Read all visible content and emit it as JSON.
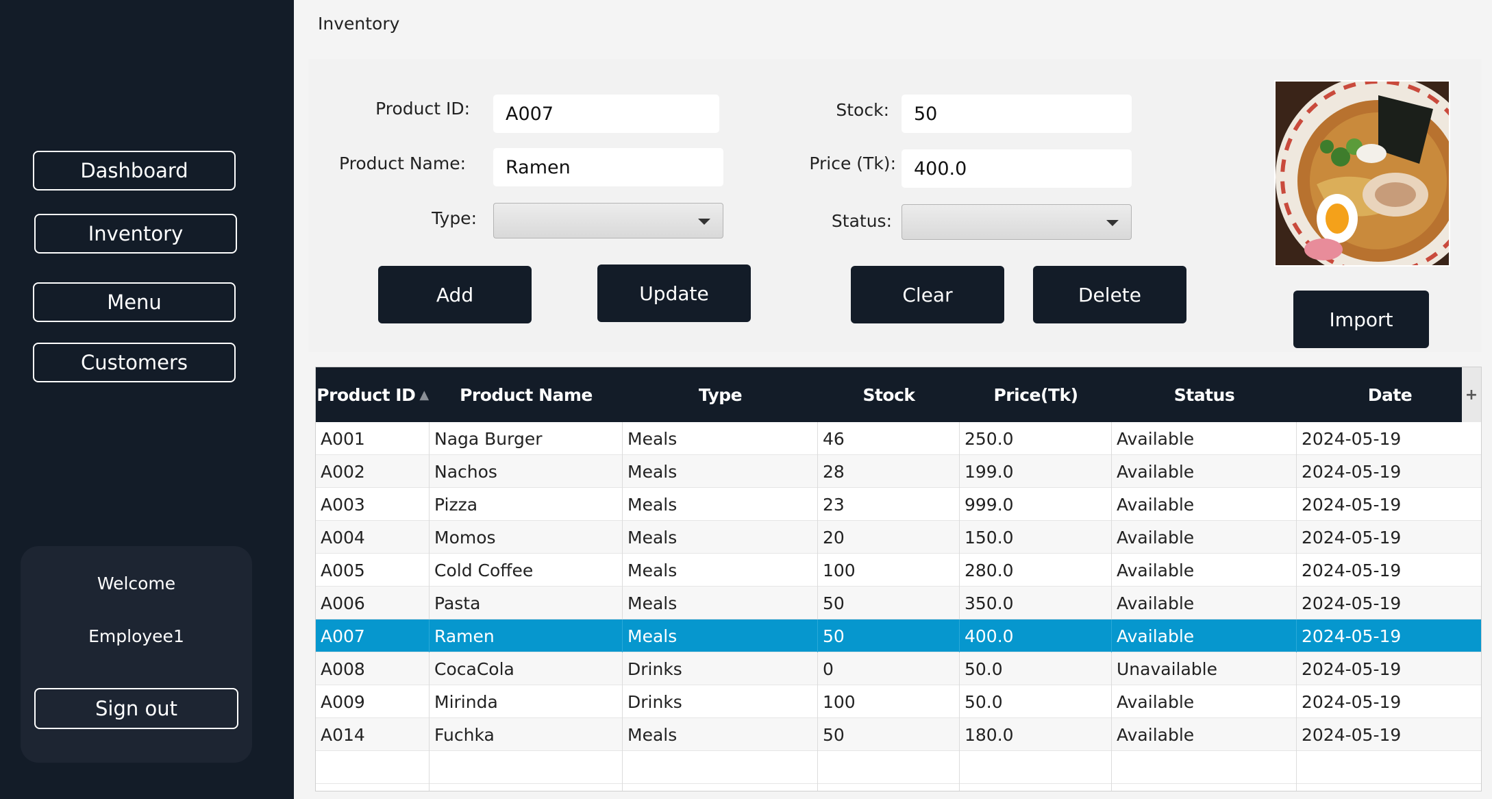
{
  "sidebar": {
    "nav": [
      {
        "label": "Dashboard"
      },
      {
        "label": "Inventory"
      },
      {
        "label": "Menu"
      },
      {
        "label": "Customers"
      }
    ],
    "welcome_label": "Welcome",
    "user_name": "Employee1",
    "sign_out_label": "Sign out"
  },
  "page": {
    "title": "Inventory"
  },
  "form": {
    "product_id_label": "Product ID:",
    "product_id_value": "A007",
    "product_name_label": "Product Name:",
    "product_name_value": "Ramen",
    "type_label": "Type:",
    "type_value": "",
    "stock_label": "Stock:",
    "stock_value": "50",
    "price_label": "Price (Tk):",
    "price_value": "400.0",
    "status_label": "Status:",
    "status_value": "",
    "buttons": {
      "add": "Add",
      "update": "Update",
      "clear": "Clear",
      "delete": "Delete",
      "import": "Import"
    }
  },
  "table": {
    "headers": [
      "Product ID",
      "Product Name",
      "Type",
      "Stock",
      "Price(Tk)",
      "Status",
      "Date"
    ],
    "sort_column": "Product ID",
    "sort_direction": "ascending",
    "corner": "+",
    "selected_row": 6,
    "rows": [
      [
        "A001",
        "Naga Burger",
        "Meals",
        "46",
        "250.0",
        "Available",
        "2024-05-19"
      ],
      [
        "A002",
        "Nachos",
        "Meals",
        "28",
        "199.0",
        "Available",
        "2024-05-19"
      ],
      [
        "A003",
        "Pizza",
        "Meals",
        "23",
        "999.0",
        "Available",
        "2024-05-19"
      ],
      [
        "A004",
        "Momos",
        "Meals",
        "20",
        "150.0",
        "Available",
        "2024-05-19"
      ],
      [
        "A005",
        "Cold Coffee",
        "Meals",
        "100",
        "280.0",
        "Available",
        "2024-05-19"
      ],
      [
        "A006",
        "Pasta",
        "Meals",
        "50",
        "350.0",
        "Available",
        "2024-05-19"
      ],
      [
        "A007",
        "Ramen",
        "Meals",
        "50",
        "400.0",
        "Available",
        "2024-05-19"
      ],
      [
        "A008",
        "CocaCola",
        "Drinks",
        "0",
        "50.0",
        "Unavailable",
        "2024-05-19"
      ],
      [
        "A009",
        "Mirinda",
        "Drinks",
        "100",
        "50.0",
        "Available",
        "2024-05-19"
      ],
      [
        "A014",
        "Fuchka",
        "Meals",
        "50",
        "180.0",
        "Available",
        "2024-05-19"
      ]
    ]
  },
  "colors": {
    "sidebar_bg": "#131c28",
    "button_bg": "#131c28",
    "selected_row": "#0697ce"
  }
}
